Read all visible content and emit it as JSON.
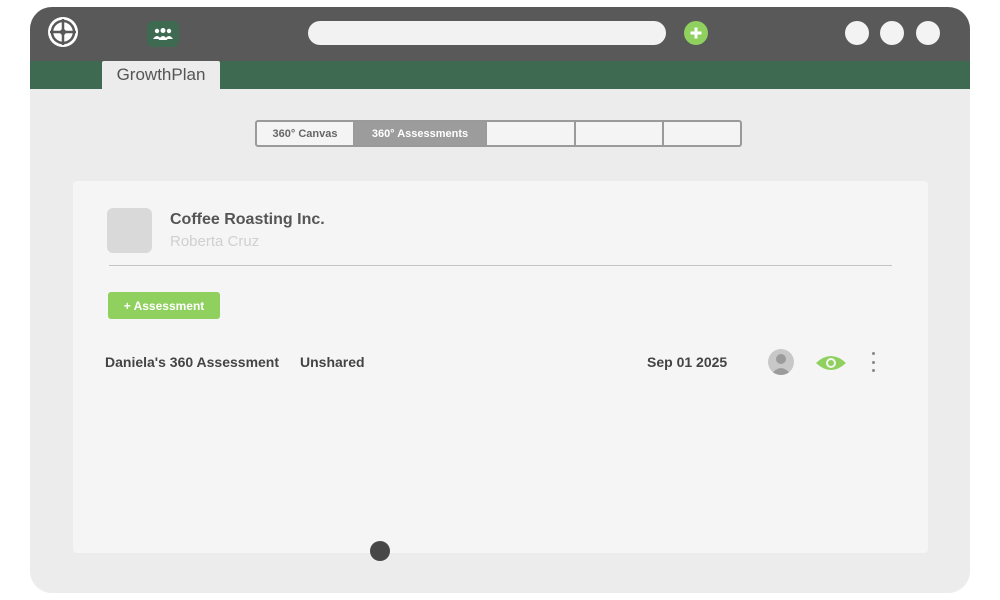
{
  "app": {
    "tab_title": "GrowthPlan"
  },
  "segments": [
    {
      "label": "360° Canvas",
      "active": false
    },
    {
      "label": "360° Assessments",
      "active": true
    },
    {
      "label": "",
      "active": false
    },
    {
      "label": "",
      "active": false
    },
    {
      "label": "",
      "active": false
    }
  ],
  "company": {
    "name": "Coffee Roasting Inc.",
    "owner": "Roberta Cruz"
  },
  "actions": {
    "add_assessment_label": "+ Assessment"
  },
  "assessments": [
    {
      "name": "Daniela's 360 Assessment",
      "status": "Unshared",
      "date": "Sep 01 2025"
    }
  ],
  "icons": {
    "app_logo": "crosshair-logo-icon",
    "team": "team-icon",
    "new_tab": "plus-circle-icon",
    "user": "user-avatar-icon",
    "view": "eye-icon",
    "more": "more-vertical-icon"
  },
  "colors": {
    "titlebar": "#595959",
    "brand_green_dark": "#3e6a52",
    "accent_green": "#8fd05f",
    "active_segment": "#9c9c9c"
  }
}
